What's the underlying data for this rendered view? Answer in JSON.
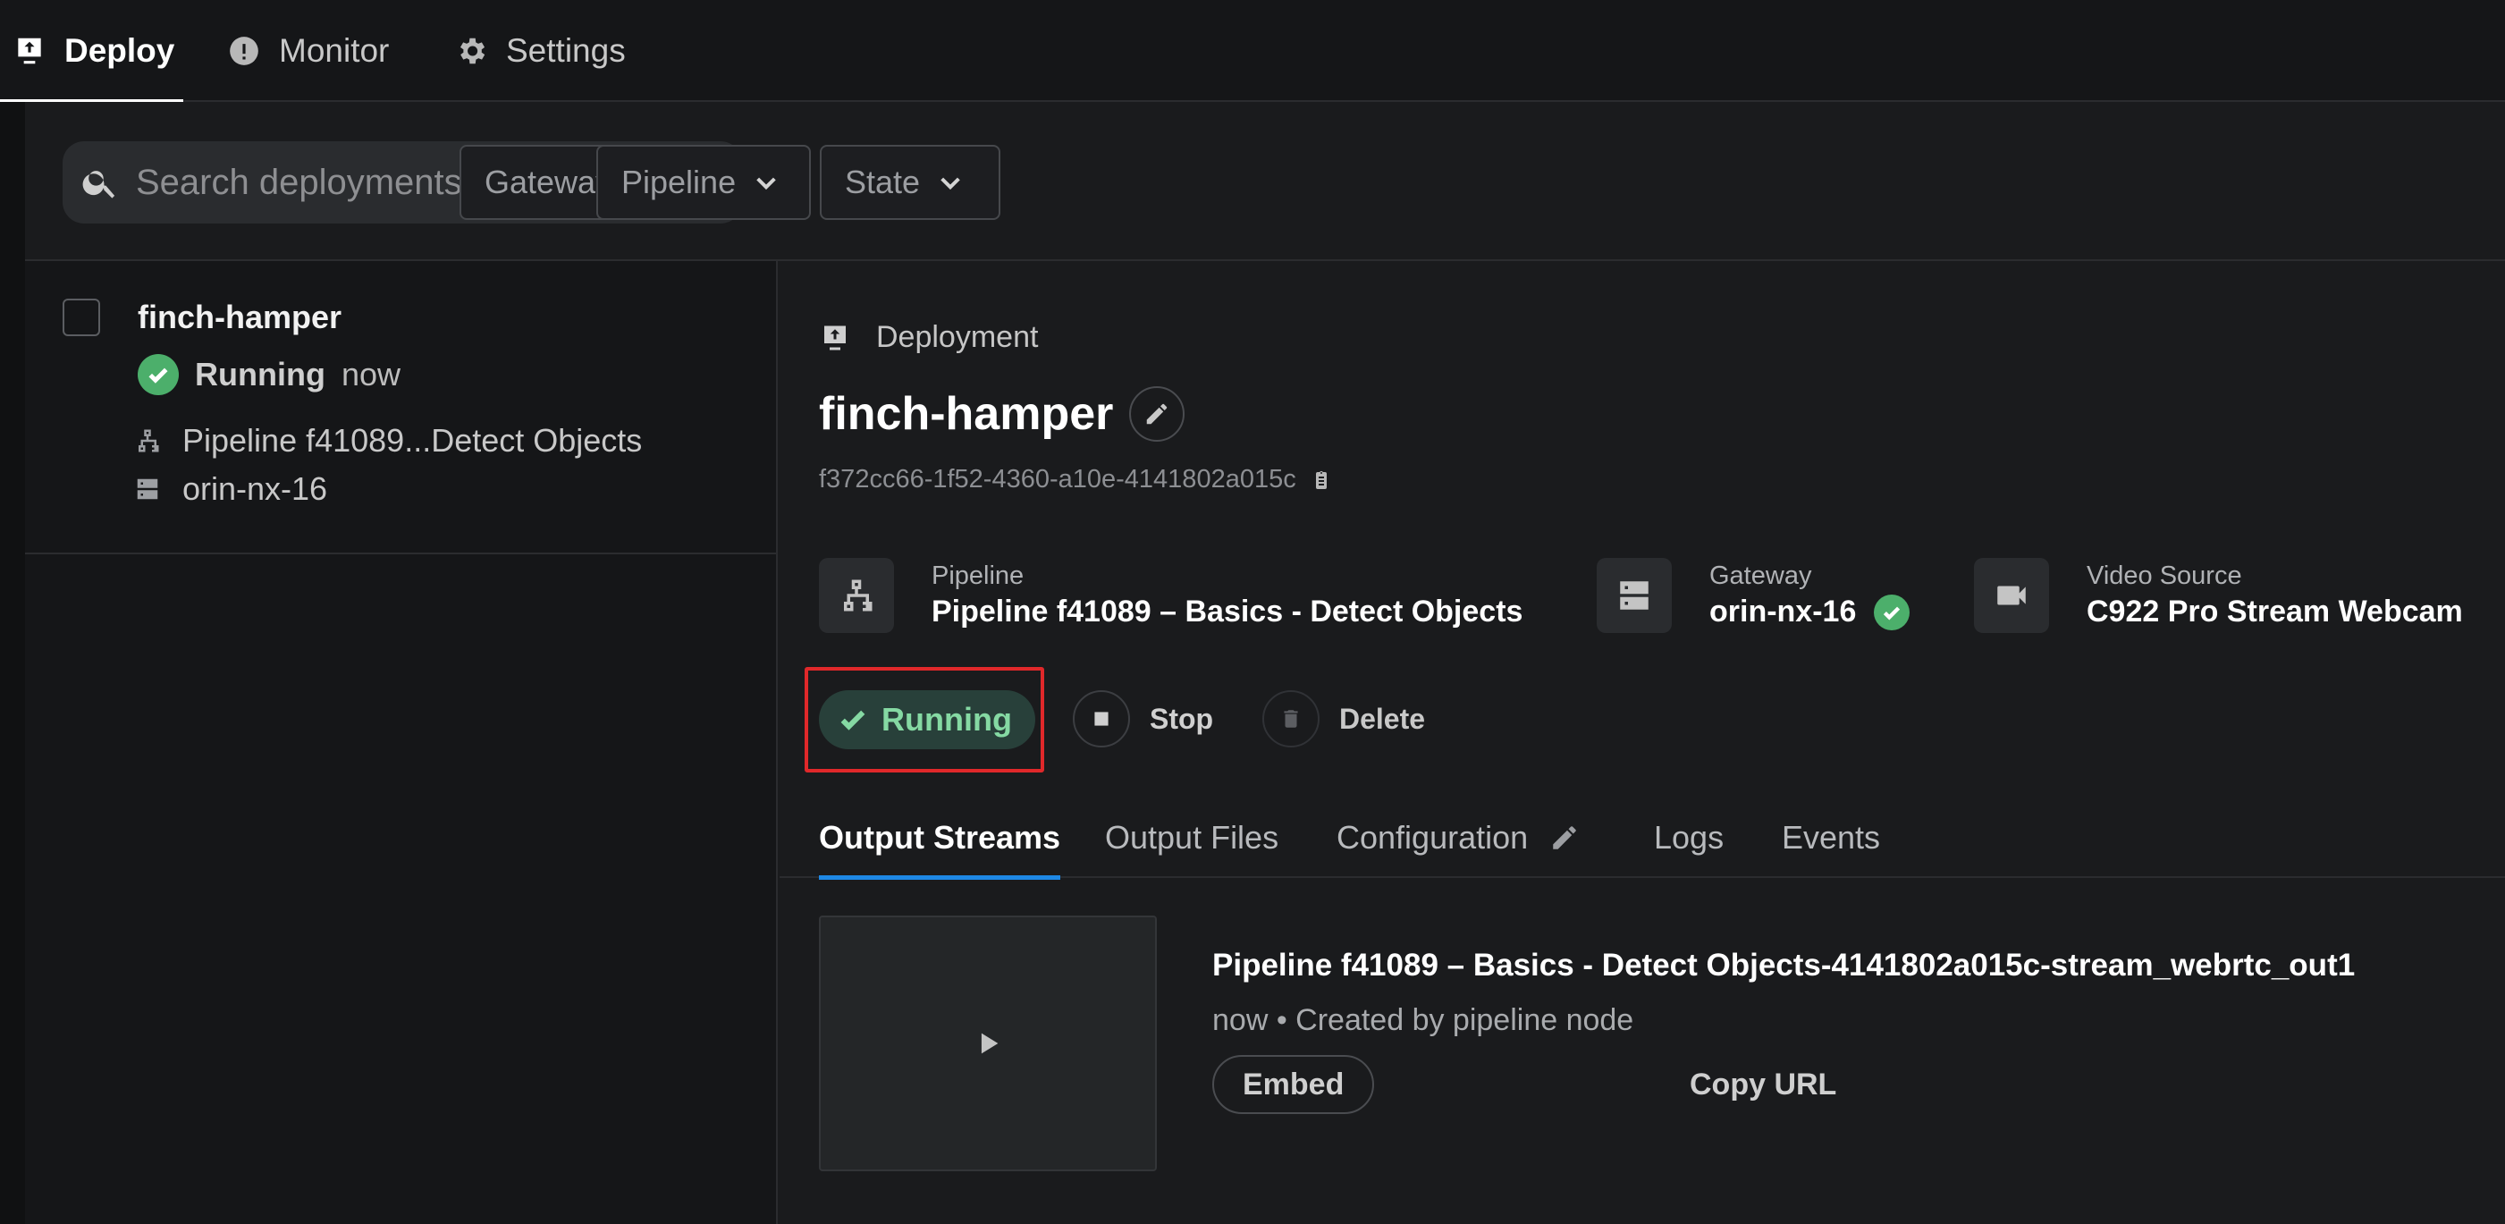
{
  "nav": {
    "tabs": [
      {
        "label": "Deploy",
        "icon": "deploy-icon"
      },
      {
        "label": "Monitor",
        "icon": "alert-circle-icon"
      },
      {
        "label": "Settings",
        "icon": "gear-icon"
      }
    ]
  },
  "filters": {
    "search_placeholder": "Search deployments...",
    "gateway": "Gateway",
    "pipeline": "Pipeline",
    "state": "State"
  },
  "list": {
    "items": [
      {
        "name": "finch-hamper",
        "status": "Running",
        "time": "now",
        "pipeline": "Pipeline f41089...Detect Objects",
        "gateway": "orin-nx-16"
      }
    ]
  },
  "detail": {
    "breadcrumb": "Deployment",
    "title": "finch-hamper",
    "id": "f372cc66-1f52-4360-a10e-4141802a015c",
    "pipeline_label": "Pipeline",
    "pipeline_value": "Pipeline f41089 – Basics - Detect Objects",
    "gateway_label": "Gateway",
    "gateway_value": "orin-nx-16",
    "video_label": "Video Source",
    "video_value": "C922 Pro Stream Webcam",
    "status": "Running",
    "stop": "Stop",
    "delete": "Delete",
    "tabs": [
      "Output Streams",
      "Output Files",
      "Configuration",
      "Logs",
      "Events"
    ],
    "stream": {
      "title": "Pipeline f41089 – Basics - Detect Objects-4141802a015c-stream_webrtc_out1",
      "subtitle": "now • Created by pipeline node",
      "embed": "Embed",
      "copy_url": "Copy URL"
    }
  },
  "colors": {
    "background": "#1a1b1d",
    "accent_tab": "#1e88e5",
    "running_green": "#4caf6b",
    "running_pill_text": "#85d9a3",
    "highlight_red": "#e0282a"
  }
}
